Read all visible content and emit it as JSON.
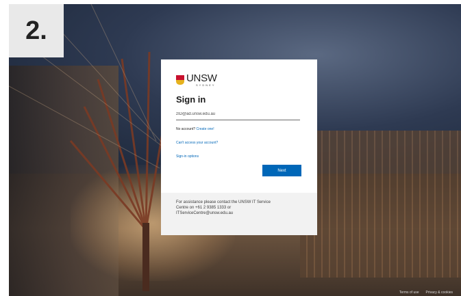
{
  "step": {
    "label": "2."
  },
  "login": {
    "logo_text": "UNSW",
    "logo_sub": "SYDNEY",
    "title": "Sign in",
    "email_value": "zID@ad.unsw.edu.au",
    "no_account_text": "No account?",
    "create_one_label": "Create one!",
    "cant_access_label": "Can't access your account?",
    "signin_options_label": "Sign-in options",
    "next_label": "Next"
  },
  "assistance": {
    "line1": "For assistance please contact the UNSW IT Service",
    "line2": "Centre on +61 2 9385 1333 or",
    "line3": "ITServiceCentre@unsw.edu.au"
  },
  "footer": {
    "terms_label": "Terms of use",
    "privacy_label": "Privacy & cookies"
  },
  "colors": {
    "accent": "#0067b8",
    "crest_red": "#c8102e",
    "crest_gold": "#e6b21e"
  }
}
